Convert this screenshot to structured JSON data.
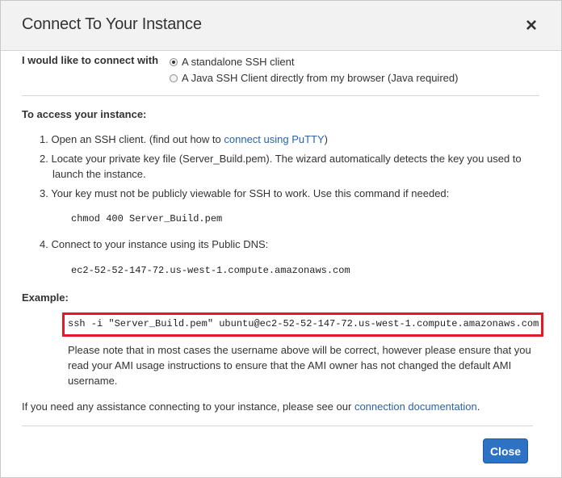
{
  "dialog": {
    "title": "Connect To Your Instance",
    "close_icon": "×",
    "close_button": "Close"
  },
  "connect_with": {
    "label": "I would like to connect with",
    "options": [
      {
        "label": "A standalone SSH client",
        "selected": true
      },
      {
        "label": "A Java SSH Client directly from my browser (Java required)",
        "selected": false
      }
    ]
  },
  "access": {
    "heading": "To access your instance:",
    "steps": [
      {
        "num": "1.",
        "text_before": "Open an SSH client. (find out how to ",
        "link": "connect using PuTTY",
        "text_after": ")"
      },
      {
        "num": "2.",
        "line1": "Locate your private key file (Server_Build.pem). The wizard automatically detects the key you used to",
        "line2": "launch the instance."
      },
      {
        "num": "3.",
        "text": "Your key must not be publicly viewable for SSH to work. Use this command if needed:"
      },
      {
        "num": "4.",
        "text": "Connect to your instance using its Public DNS:"
      }
    ],
    "chmod_command": "chmod 400 Server_Build.pem",
    "public_dns": "ec2-52-52-147-72.us-west-1.compute.amazonaws.com"
  },
  "example": {
    "heading": "Example:",
    "command": "ssh -i \"Server_Build.pem\" ubuntu@ec2-52-52-147-72.us-west-1.compute.amazonaws.com",
    "note": "Please note that in most cases the username above will be correct, however please ensure that you read your AMI usage instructions to ensure that the AMI owner has not changed the default AMI username.",
    "highlight_color": "#e01b24"
  },
  "assistance": {
    "text": "If you need any assistance connecting to your instance, please see our ",
    "link": "connection documentation",
    "suffix": "."
  },
  "colors": {
    "link": "#2a63a8",
    "primary_button": "#2e72c4"
  }
}
